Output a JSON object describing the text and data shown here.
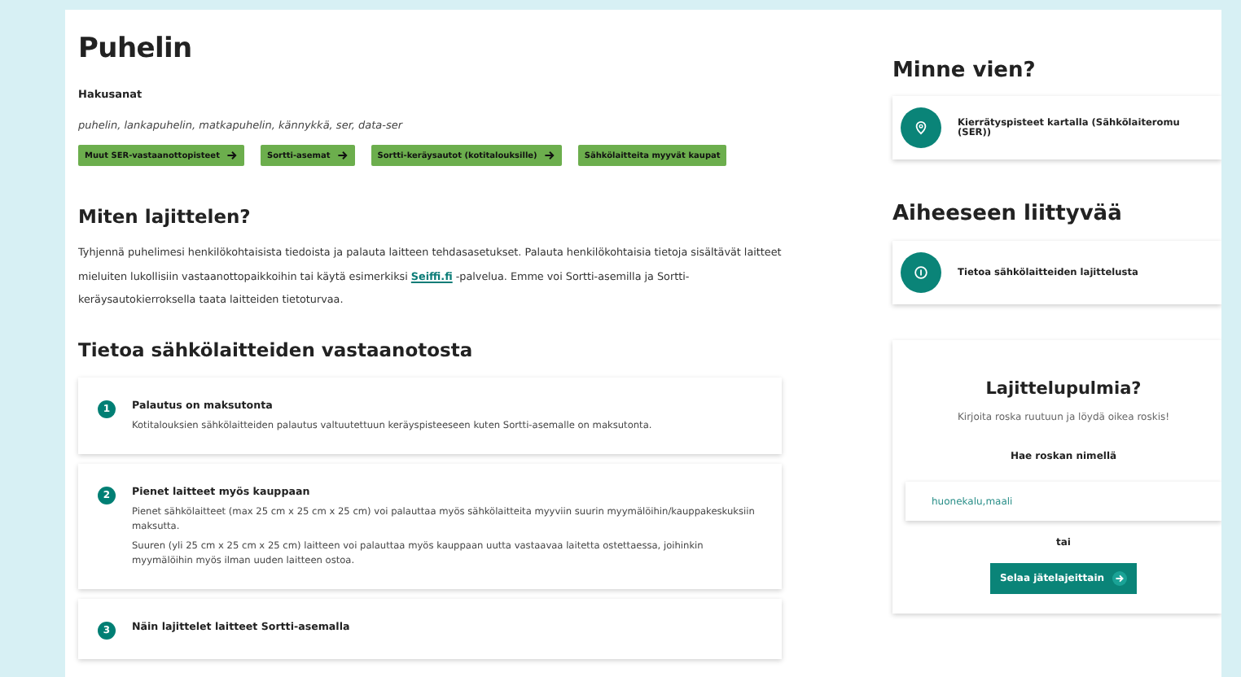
{
  "page": {
    "title": "Puhelin",
    "keywords_label": "Hakusanat",
    "keywords": "puhelin, lankapuhelin, matkapuhelin, kännykkä, ser, data-ser",
    "link_buttons": [
      {
        "label": "Muut SER-vastaanottopisteet",
        "arrow": true
      },
      {
        "label": "Sortti-asemat",
        "arrow": true
      },
      {
        "label": "Sortti-keräysautot (kotitalouksille)",
        "arrow": true
      },
      {
        "label": "Sähkölaitteita myyvät kaupat",
        "arrow": false
      }
    ]
  },
  "how_to_sort": {
    "heading": "Miten lajittelen?",
    "text_before": "Tyhjennä puhelimesi henkilökohtaisista tiedoista ja palauta laitteen tehdasasetukset. Palauta henkilökohtaisia tietoja sisältävät laitteet mieluiten lukollisiin vastaanottopaikkoihin tai käytä esimerkiksi ",
    "link": "Seiffi.fi",
    "text_after": " -palvelua. Emme voi Sortti-asemilla ja Sortti-keräysautokierroksella taata laitteiden tietoturvaa."
  },
  "info": {
    "heading": "Tietoa sähkölaitteiden vastaanotosta",
    "cards": [
      {
        "number": "1",
        "title": "Palautus on maksutonta",
        "paragraphs": [
          "Kotitalouksien sähkölaitteiden palautus valtuutettuun keräyspisteeseen kuten Sortti-asemalle on maksutonta."
        ]
      },
      {
        "number": "2",
        "title": "Pienet laitteet myös kauppaan",
        "paragraphs": [
          "Pienet sähkölaitteet (max 25 cm x 25 cm x 25 cm) voi palauttaa myös sähkölaitteita myyviin suurin myymälöihin/kauppakeskuksiin maksutta.",
          "Suuren (yli 25 cm x 25 cm x 25 cm) laitteen voi palauttaa myös kauppaan uutta vastaavaa laitetta ostettaessa, joihinkin myymälöihin myös ilman uuden laitteen ostoa."
        ]
      },
      {
        "number": "3",
        "title": "Näin lajittelet laitteet Sortti-asemalla"
      }
    ]
  },
  "sidebar": {
    "where_heading": "Minne vien?",
    "where_link": {
      "kind": "map",
      "label": "Kierrätyspisteet kartalla (Sähkölaiteromu (SER))"
    },
    "related_heading": "Aiheeseen liittyvää",
    "related_link": {
      "kind": "info",
      "label": "Tietoa sähkölaitteiden lajittelusta"
    },
    "sorting_help": {
      "title": "Lajittelupulmia?",
      "subtitle": "Kirjoita roska ruutuun ja löydä oikea roskis!",
      "search_label": "Hae roskan nimellä",
      "search": {
        "placeholder": "huonekalu,maali"
      },
      "or": "tai",
      "browse_button": "Selaa jätelajeittain"
    }
  }
}
